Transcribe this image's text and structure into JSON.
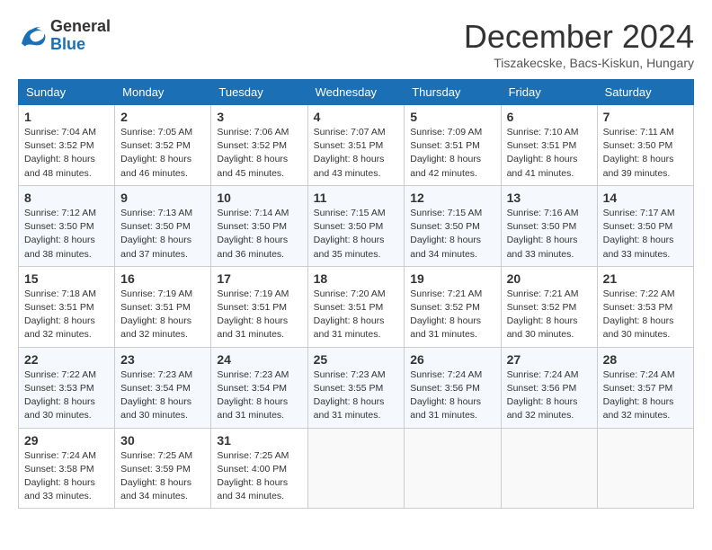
{
  "logo": {
    "line1": "General",
    "line2": "Blue"
  },
  "title": "December 2024",
  "location": "Tiszakecske, Bacs-Kiskun, Hungary",
  "days_of_week": [
    "Sunday",
    "Monday",
    "Tuesday",
    "Wednesday",
    "Thursday",
    "Friday",
    "Saturday"
  ],
  "weeks": [
    [
      {
        "day": "1",
        "sunrise": "7:04 AM",
        "sunset": "3:52 PM",
        "daylight": "8 hours and 48 minutes."
      },
      {
        "day": "2",
        "sunrise": "7:05 AM",
        "sunset": "3:52 PM",
        "daylight": "8 hours and 46 minutes."
      },
      {
        "day": "3",
        "sunrise": "7:06 AM",
        "sunset": "3:52 PM",
        "daylight": "8 hours and 45 minutes."
      },
      {
        "day": "4",
        "sunrise": "7:07 AM",
        "sunset": "3:51 PM",
        "daylight": "8 hours and 43 minutes."
      },
      {
        "day": "5",
        "sunrise": "7:09 AM",
        "sunset": "3:51 PM",
        "daylight": "8 hours and 42 minutes."
      },
      {
        "day": "6",
        "sunrise": "7:10 AM",
        "sunset": "3:51 PM",
        "daylight": "8 hours and 41 minutes."
      },
      {
        "day": "7",
        "sunrise": "7:11 AM",
        "sunset": "3:50 PM",
        "daylight": "8 hours and 39 minutes."
      }
    ],
    [
      {
        "day": "8",
        "sunrise": "7:12 AM",
        "sunset": "3:50 PM",
        "daylight": "8 hours and 38 minutes."
      },
      {
        "day": "9",
        "sunrise": "7:13 AM",
        "sunset": "3:50 PM",
        "daylight": "8 hours and 37 minutes."
      },
      {
        "day": "10",
        "sunrise": "7:14 AM",
        "sunset": "3:50 PM",
        "daylight": "8 hours and 36 minutes."
      },
      {
        "day": "11",
        "sunrise": "7:15 AM",
        "sunset": "3:50 PM",
        "daylight": "8 hours and 35 minutes."
      },
      {
        "day": "12",
        "sunrise": "7:15 AM",
        "sunset": "3:50 PM",
        "daylight": "8 hours and 34 minutes."
      },
      {
        "day": "13",
        "sunrise": "7:16 AM",
        "sunset": "3:50 PM",
        "daylight": "8 hours and 33 minutes."
      },
      {
        "day": "14",
        "sunrise": "7:17 AM",
        "sunset": "3:50 PM",
        "daylight": "8 hours and 33 minutes."
      }
    ],
    [
      {
        "day": "15",
        "sunrise": "7:18 AM",
        "sunset": "3:51 PM",
        "daylight": "8 hours and 32 minutes."
      },
      {
        "day": "16",
        "sunrise": "7:19 AM",
        "sunset": "3:51 PM",
        "daylight": "8 hours and 32 minutes."
      },
      {
        "day": "17",
        "sunrise": "7:19 AM",
        "sunset": "3:51 PM",
        "daylight": "8 hours and 31 minutes."
      },
      {
        "day": "18",
        "sunrise": "7:20 AM",
        "sunset": "3:51 PM",
        "daylight": "8 hours and 31 minutes."
      },
      {
        "day": "19",
        "sunrise": "7:21 AM",
        "sunset": "3:52 PM",
        "daylight": "8 hours and 31 minutes."
      },
      {
        "day": "20",
        "sunrise": "7:21 AM",
        "sunset": "3:52 PM",
        "daylight": "8 hours and 30 minutes."
      },
      {
        "day": "21",
        "sunrise": "7:22 AM",
        "sunset": "3:53 PM",
        "daylight": "8 hours and 30 minutes."
      }
    ],
    [
      {
        "day": "22",
        "sunrise": "7:22 AM",
        "sunset": "3:53 PM",
        "daylight": "8 hours and 30 minutes."
      },
      {
        "day": "23",
        "sunrise": "7:23 AM",
        "sunset": "3:54 PM",
        "daylight": "8 hours and 30 minutes."
      },
      {
        "day": "24",
        "sunrise": "7:23 AM",
        "sunset": "3:54 PM",
        "daylight": "8 hours and 31 minutes."
      },
      {
        "day": "25",
        "sunrise": "7:23 AM",
        "sunset": "3:55 PM",
        "daylight": "8 hours and 31 minutes."
      },
      {
        "day": "26",
        "sunrise": "7:24 AM",
        "sunset": "3:56 PM",
        "daylight": "8 hours and 31 minutes."
      },
      {
        "day": "27",
        "sunrise": "7:24 AM",
        "sunset": "3:56 PM",
        "daylight": "8 hours and 32 minutes."
      },
      {
        "day": "28",
        "sunrise": "7:24 AM",
        "sunset": "3:57 PM",
        "daylight": "8 hours and 32 minutes."
      }
    ],
    [
      {
        "day": "29",
        "sunrise": "7:24 AM",
        "sunset": "3:58 PM",
        "daylight": "8 hours and 33 minutes."
      },
      {
        "day": "30",
        "sunrise": "7:25 AM",
        "sunset": "3:59 PM",
        "daylight": "8 hours and 34 minutes."
      },
      {
        "day": "31",
        "sunrise": "7:25 AM",
        "sunset": "4:00 PM",
        "daylight": "8 hours and 34 minutes."
      },
      null,
      null,
      null,
      null
    ]
  ]
}
